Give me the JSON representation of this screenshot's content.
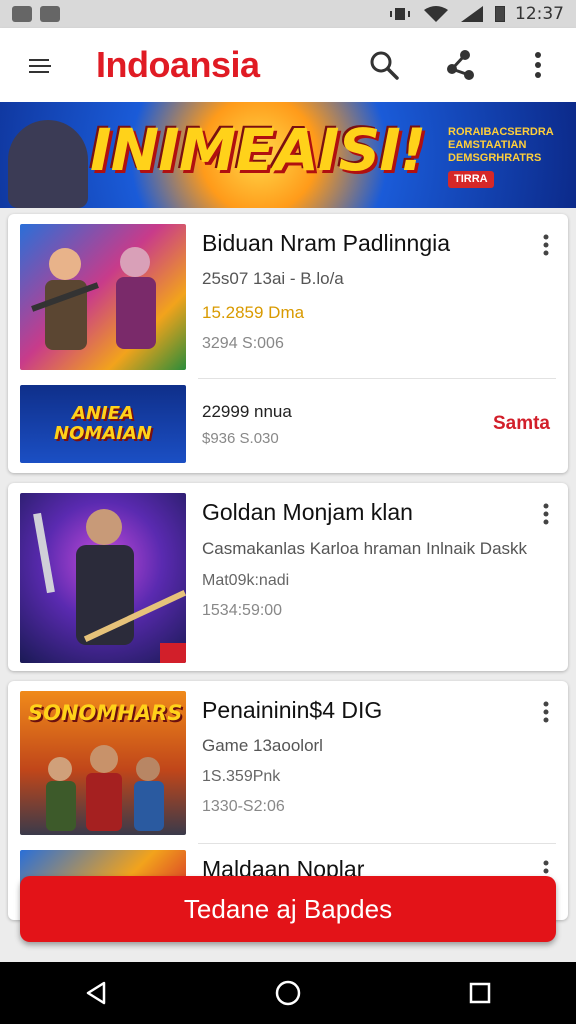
{
  "status_bar": {
    "time": "12:37"
  },
  "app_bar": {
    "title": "Indoansia",
    "actions": [
      "search-icon",
      "share-icon",
      "more-vert-icon"
    ]
  },
  "banner": {
    "headline": "INIMEAISI!",
    "side_lines": [
      "RORAIBACSERDRA",
      "EAMSTAATIAN",
      "DEMSGRHRATRS"
    ],
    "tag": "TIRRA"
  },
  "cards": [
    {
      "title": "Biduan Nram Padlinngia",
      "line1": "25s07 13ai - B.lo/a",
      "price": "15.2859 Dma",
      "muted": "3294 S:006",
      "sub": {
        "title": "22999 nnua",
        "detail": "$936 S.030",
        "action": "Samta",
        "banner_text": "ANIEA NOMAIAN"
      }
    },
    {
      "title": "Goldan Monjam klan",
      "line1": "Casmakanlas Karloa hraman Inlnaik Daskk",
      "price": "Mat09k:nadi",
      "muted": "1534:59:00"
    },
    {
      "title": "Penaininin$4 DIG",
      "line1": "Game 13aoolorl",
      "price": "1S.359Pnk",
      "muted": "1330-S2:06",
      "thumb_text": "SONOMHARS"
    },
    {
      "title": "Maldaan Noplar"
    }
  ],
  "cta": {
    "label": "Tedane aj Bapdes"
  },
  "colors": {
    "brand": "#e01b24",
    "price": "#d99a00",
    "cta": "#e31318"
  }
}
